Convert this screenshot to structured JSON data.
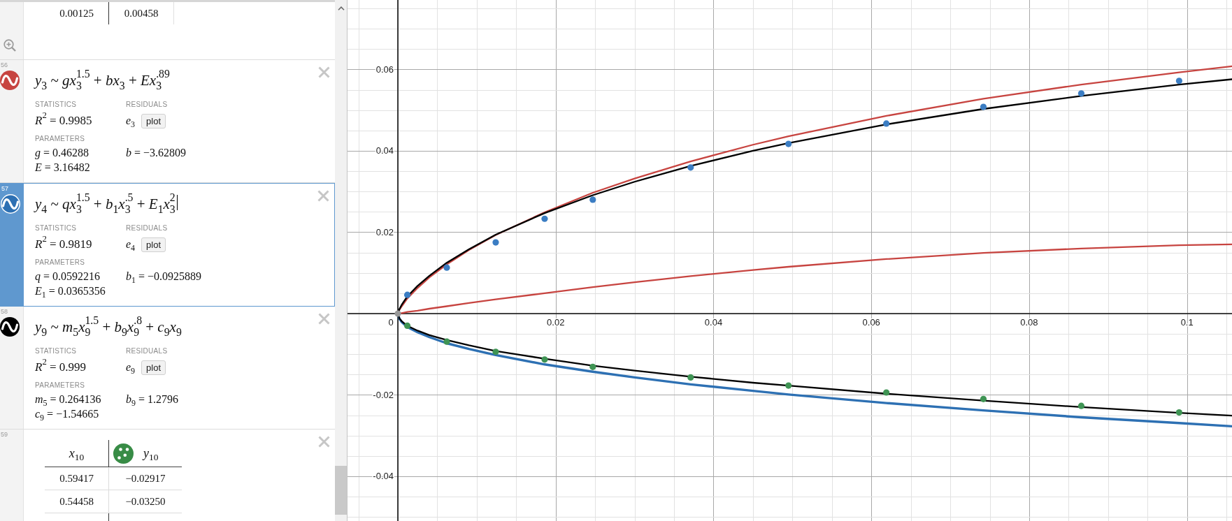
{
  "expression_list": {
    "top_table": {
      "rows": [
        [
          "0.00125",
          "0.00458"
        ]
      ]
    },
    "expressions": [
      {
        "kind": "regression",
        "number": "56",
        "color": "#c74440",
        "selected": false,
        "formula": "*y*$_{3}$ ~ *gx*$_{3}$$^{1.5}$ + *bx*$_{3}$ + *Ex*$_{3}$$^{.89}$",
        "statistics_label": "STATISTICS",
        "r_squared": "*R*$^{2}$ = 0.9985",
        "residuals_label": "RESIDUALS",
        "residual": "*e*$_{3}$",
        "plot_button": "plot",
        "parameters_label": "PARAMETERS",
        "parameters": [
          "*g* = 0.46288",
          "*b* = −3.62809",
          "*E* = 3.16482"
        ]
      },
      {
        "kind": "regression",
        "number": "57",
        "color": "#2d70b3",
        "selected": true,
        "formula": "*y*$_{4}$ ~ *qx*$_{3}$$^{1.5}$ + *b*$_{1}$*x*$_{3}$$^{.5}$ + *E*$_{1}$*x*$_{3}$$^{2}$",
        "statistics_label": "STATISTICS",
        "r_squared": "*R*$^{2}$ = 0.9819",
        "residuals_label": "RESIDUALS",
        "residual": "*e*$_{4}$",
        "plot_button": "plot",
        "parameters_label": "PARAMETERS",
        "parameters": [
          "*q* = 0.0592216",
          "*b*$_{1}$ = −0.0925889",
          "*E*$_{1}$ = 0.0365356"
        ]
      },
      {
        "kind": "regression",
        "number": "58",
        "color": "#000000",
        "selected": false,
        "formula": "*y*$_{9}$ ~ *m*$_{5}$*x*$_{9}$$^{1.5}$ + *b*$_{9}$*x*$_{9}$$^{.8}$ + *c*$_{9}$*x*$_{9}$",
        "statistics_label": "STATISTICS",
        "r_squared": "*R*$^{2}$ = 0.999",
        "residuals_label": "RESIDUALS",
        "residual": "*e*$_{9}$",
        "plot_button": "plot",
        "parameters_label": "PARAMETERS",
        "parameters": [
          "*m*$_{5}$ = 0.264136",
          "*b*$_{9}$ = 1.2796",
          "*c*$_{9}$ = −1.54665"
        ]
      },
      {
        "kind": "table",
        "number": "59",
        "columns": [
          {
            "label": "*x*$_{10}$"
          },
          {
            "label": "*y*$_{10}$",
            "color": "#388c46"
          }
        ],
        "rows": [
          [
            "0.59417",
            "−0.02917"
          ],
          [
            "0.54458",
            "−0.03250"
          ]
        ]
      }
    ]
  },
  "graph": {
    "origin_label": "0",
    "fit_curves": {
      "chart_data": {
        "type": "line",
        "grid": true,
        "x": [
          0,
          0.0002,
          0.0005,
          0.0012,
          0.0025,
          0.004,
          0.0062,
          0.009,
          0.0124,
          0.0186,
          0.0247,
          0.03,
          0.0371,
          0.045,
          0.0495,
          0.0619,
          0.0742,
          0.0866,
          0.099,
          0.1057
        ],
        "xlim": [
          -0.00638,
          0.1057
        ],
        "ylim": [
          -0.05099,
          0.07708
        ],
        "xticks": [
          0.02,
          0.04,
          0.06,
          0.08,
          0.1
        ],
        "yticks": [
          -0.04,
          -0.02,
          0.02,
          0.04,
          0.06
        ],
        "series": [
          {
            "color": "#c74440",
            "values": [
              0,
              0.0009,
              0.0018,
              0.0037,
              0.0063,
              0.0089,
              0.0121,
              0.0156,
              0.0193,
              0.0249,
              0.0297,
              0.0332,
              0.0374,
              0.0415,
              0.0436,
              0.0486,
              0.0528,
              0.0563,
              0.0593,
              0.0608
            ]
          },
          {
            "color": "#c74440",
            "values": [
              0,
              0.0001,
              0.0001,
              0.0004,
              0.0007,
              0.0012,
              0.0018,
              0.0026,
              0.0035,
              0.005,
              0.0065,
              0.0077,
              0.0092,
              0.0107,
              0.0115,
              0.0134,
              0.0149,
              0.016,
              0.0168,
              0.017
            ]
          },
          {
            "color": "#2d70b3",
            "values": [
              0,
              -0.0013,
              -0.0021,
              -0.0033,
              -0.0046,
              -0.0058,
              -0.0073,
              -0.0087,
              -0.0102,
              -0.0125,
              -0.0143,
              -0.0157,
              -0.0174,
              -0.019,
              -0.0199,
              -0.022,
              -0.0238,
              -0.0255,
              -0.0269,
              -0.0277
            ]
          },
          {
            "color": "#000000",
            "values": [
              0,
              0.0011,
              0.0022,
              0.0042,
              0.0068,
              0.0093,
              0.0125,
              0.0158,
              0.0194,
              0.0247,
              0.0291,
              0.0324,
              0.0363,
              0.04,
              0.0419,
              0.0465,
              0.0503,
              0.0535,
              0.0563,
              0.0576
            ]
          },
          {
            "color": "#000000",
            "values": [
              0,
              -0.0012,
              -0.0019,
              -0.003,
              -0.0042,
              -0.0053,
              -0.0065,
              -0.0078,
              -0.0092,
              -0.0111,
              -0.0128,
              -0.014,
              -0.0155,
              -0.017,
              -0.0177,
              -0.0197,
              -0.0214,
              -0.023,
              -0.0244,
              -0.0251
            ]
          }
        ]
      }
    },
    "data_points": {
      "chart_data": {
        "type": "scatter",
        "x": [
          0,
          0.0012,
          0.0062,
          0.0124,
          0.0186,
          0.0247,
          0.0371,
          0.0495,
          0.0619,
          0.0742,
          0.0866,
          0.099
        ],
        "xlim": [
          -0.00638,
          0.1057
        ],
        "ylim": [
          -0.05099,
          0.07708
        ],
        "series": [
          {
            "color": "#3b7dc3",
            "values": [
              null,
              0.0046,
              0.0113,
              0.0175,
              0.0233,
              0.028,
              0.0359,
              0.0417,
              0.0467,
              0.0508,
              0.0541,
              0.0572
            ]
          },
          {
            "color": "#3f9454",
            "values": [
              null,
              -0.003,
              -0.0069,
              -0.0094,
              -0.0113,
              -0.0131,
              -0.0157,
              -0.0177,
              -0.0194,
              -0.021,
              -0.0227,
              -0.0243
            ]
          },
          {
            "color": "#999999",
            "values": [
              0,
              null,
              null,
              null,
              null,
              null,
              null,
              null,
              null,
              null,
              null,
              null
            ]
          }
        ]
      }
    }
  }
}
